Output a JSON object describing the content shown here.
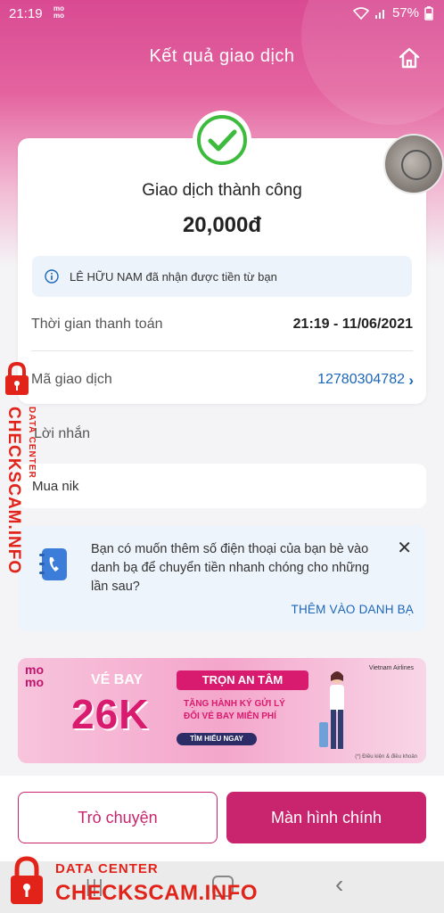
{
  "status_bar": {
    "time": "21:19",
    "app_mark": "mo mo",
    "battery": "57%"
  },
  "header": {
    "title": "Kết quả giao dịch",
    "home_icon": "home-icon"
  },
  "result": {
    "status_text": "Giao dịch thành công",
    "amount": "20,000đ",
    "info_text": "LÊ HỮU NAM đã nhận được tiền từ bạn",
    "pay_time_label": "Thời gian thanh toán",
    "pay_time_value": "21:19 - 11/06/2021",
    "txid_label": "Mã giao dịch",
    "txid_value": "12780304782"
  },
  "message": {
    "label": "Lời nhắn",
    "text": "Mua nik"
  },
  "contact_prompt": {
    "text": "Bạn có muốn thêm số điện thoại của bạn bè vào danh bạ để chuyển tiền nhanh chóng cho những lần sau?",
    "action": "THÊM VÀO DANH BẠ"
  },
  "banner": {
    "logo_line1": "mo",
    "logo_line2": "mo",
    "big_1": "VÉ BAY",
    "big_2": "26K",
    "pill": "TRỌN AN TÂM",
    "line_1": "TẶNG HÀNH KÝ GỬI LÝ",
    "line_2": "ĐỔI VÉ BAY MIỄN PHÍ",
    "button": "TÌM HIỂU NGAY",
    "airline": "Vietnam Airlines",
    "note": "(*) Điều kiện & điều khoản"
  },
  "actions": {
    "chat": "Trò chuyện",
    "home": "Màn hình chính"
  },
  "watermark": {
    "sub": "DATA CENTER",
    "main": "CHECKSCAM.INFO"
  },
  "colors": {
    "brand": "#c9256e",
    "link": "#1b66b8",
    "success": "#3dbb3d",
    "watermark": "#e2231a"
  }
}
